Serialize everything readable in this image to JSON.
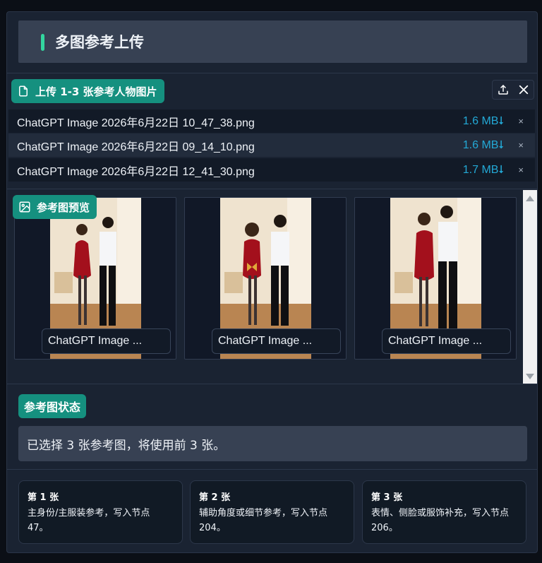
{
  "header": {
    "title": "多图参考上传"
  },
  "upload": {
    "badge_label": "上传 1-3 张参考人物图片",
    "files": [
      {
        "name": "ChatGPT Image 2026年6月22日 10_47_38.png",
        "size": "1.6 MB",
        "close": "×"
      },
      {
        "name": "ChatGPT Image 2026年6月22日 09_14_10.png",
        "size": "1.6 MB",
        "close": "×"
      },
      {
        "name": "ChatGPT Image 2026年6月22日 12_41_30.png",
        "size": "1.7 MB",
        "close": "×"
      }
    ],
    "icons": [
      "upload-icon",
      "close-icon"
    ]
  },
  "preview": {
    "badge_label": "参考图预览",
    "thumbs": [
      {
        "caption": "ChatGPT Image ..."
      },
      {
        "caption": "ChatGPT Image ..."
      },
      {
        "caption": "ChatGPT Image ..."
      }
    ]
  },
  "status": {
    "badge_label": "参考图状态",
    "message": "已选择 3 张参考图，将使用前 3 张。"
  },
  "roles": [
    {
      "title": "第 1 张",
      "desc": "主身份/主服装参考，写入节点 47。"
    },
    {
      "title": "第 2 张",
      "desc": "辅助角度或细节参考，写入节点 204。"
    },
    {
      "title": "第 3 张",
      "desc": "表情、侧脸或服饰补充，写入节点 206。"
    }
  ],
  "colors": {
    "accent": "#15907f",
    "accent_bar": "#33d69f",
    "file_size": "#23a9d6",
    "panel": "#1a2332"
  }
}
